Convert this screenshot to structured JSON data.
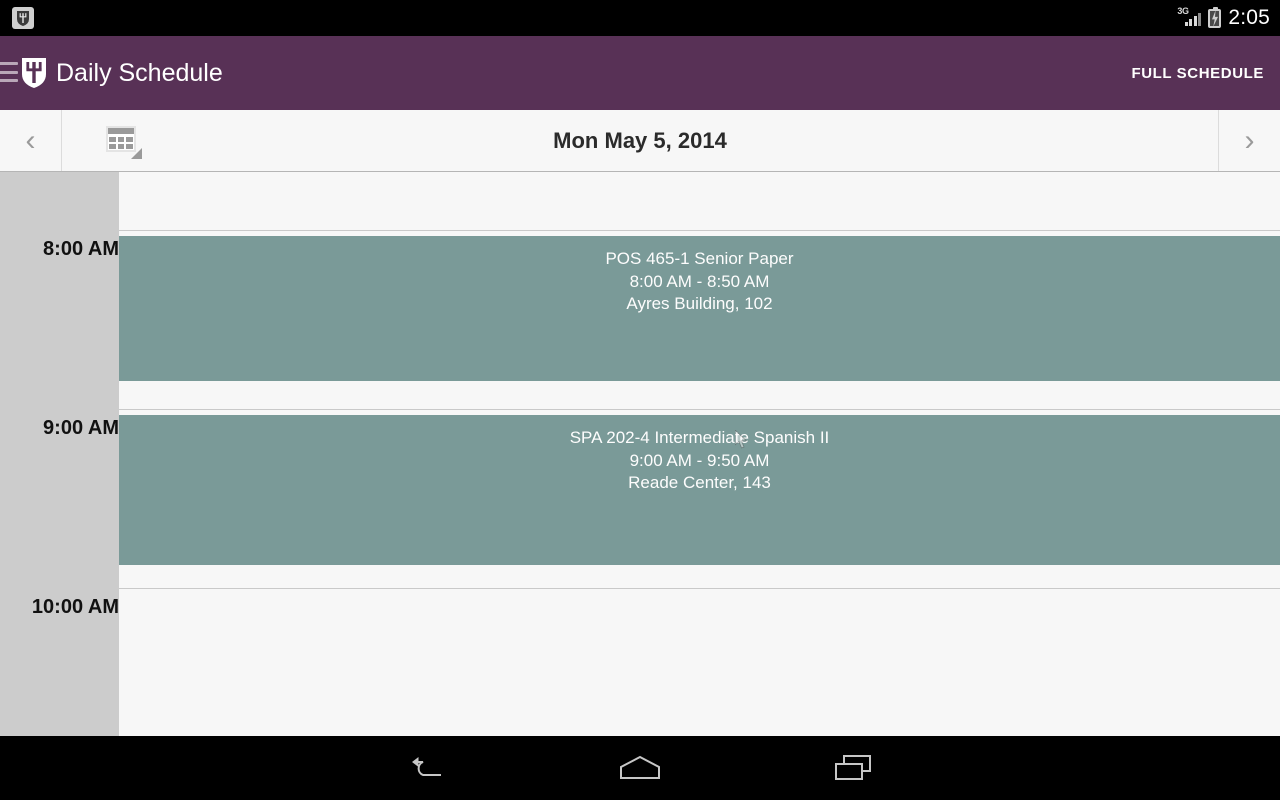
{
  "status_bar": {
    "app_icon": "shield-trident-icon",
    "network_label": "3G",
    "signal_icon": "signal-bars-icon",
    "battery_icon": "battery-charging-icon",
    "clock": "2:05"
  },
  "action_bar": {
    "drawer_icon": "hamburger-menu-icon",
    "logo_icon": "shield-trident-logo",
    "title": "Daily Schedule",
    "action_label": "FULL SCHEDULE",
    "background_color": "#583156",
    "title_color": "#ffffff"
  },
  "date_bar": {
    "prev_icon": "‹",
    "next_icon": "›",
    "datepicker_icon": "calendar-picker-icon",
    "date": "Mon May 5, 2014",
    "background_color": "#f7f7f7"
  },
  "day_grid": {
    "gutter_color": "#cccccc",
    "canvas_color": "#f7f7f7",
    "event_color": "#7a9a98",
    "hour_labels": [
      "8:00 AM",
      "9:00 AM",
      "10:00 AM"
    ],
    "events": [
      {
        "title": "POS 465-1 Senior Paper",
        "time": "8:00 AM - 8:50 AM",
        "location": "Ayres Building, 102"
      },
      {
        "title": "SPA 202-4 Intermediate Spanish II",
        "time": "9:00 AM - 9:50 AM",
        "location": "Reade Center, 143"
      }
    ]
  },
  "nav_bar": {
    "back_icon": "back-arrow-icon",
    "home_icon": "home-icon",
    "recents_icon": "recent-apps-icon"
  }
}
